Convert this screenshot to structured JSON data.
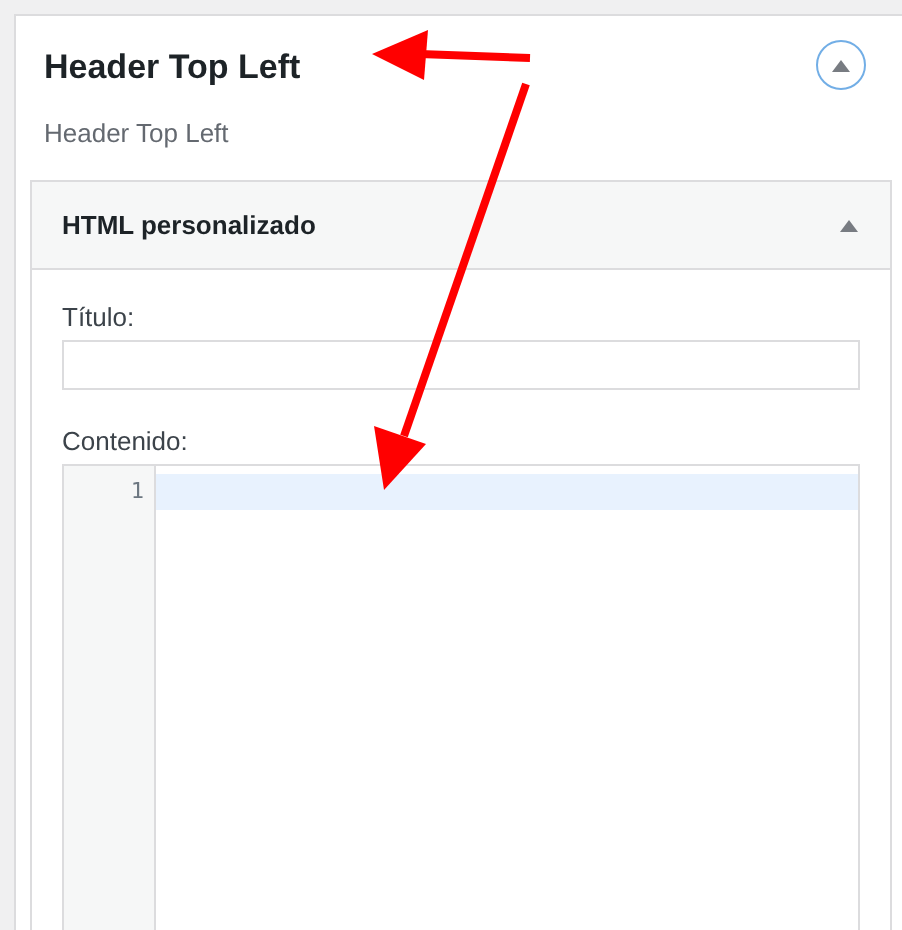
{
  "sidebar_area": {
    "title": "Header Top Left",
    "description": "Header Top Left",
    "expanded": true
  },
  "widget": {
    "title": "HTML personalizado",
    "expanded": true,
    "fields": [
      {
        "kind": "input",
        "label": "Título:"
      },
      {
        "kind": "code",
        "label": "Contenido:",
        "line_numbers": [
          "1"
        ]
      }
    ]
  }
}
